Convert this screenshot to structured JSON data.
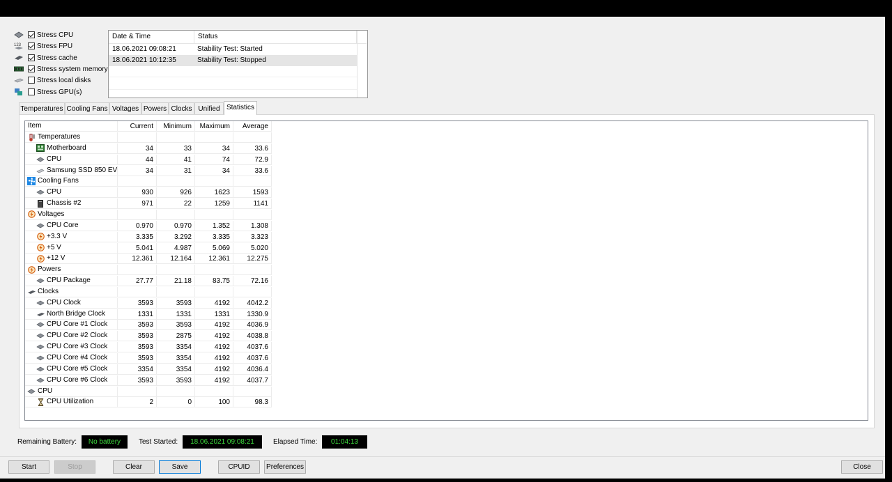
{
  "stress_options": [
    {
      "label": "Stress CPU",
      "checked": true,
      "icon": "cpu-chip-icon"
    },
    {
      "label": "Stress FPU",
      "checked": true,
      "icon": "fpu-123-icon"
    },
    {
      "label": "Stress cache",
      "checked": true,
      "icon": "cache-chip-icon"
    },
    {
      "label": "Stress system memory",
      "checked": true,
      "icon": "memory-module-icon"
    },
    {
      "label": "Stress local disks",
      "checked": false,
      "icon": "disk-drive-icon"
    },
    {
      "label": "Stress GPU(s)",
      "checked": false,
      "icon": "gpu-card-icon"
    }
  ],
  "log": {
    "headers": [
      "Date & Time",
      "Status"
    ],
    "rows": [
      {
        "datetime": "18.06.2021 09:08:21",
        "status": "Stability Test: Started"
      },
      {
        "datetime": "18.06.2021 10:12:35",
        "status": "Stability Test: Stopped"
      }
    ]
  },
  "tabs": [
    "Temperatures",
    "Cooling Fans",
    "Voltages",
    "Powers",
    "Clocks",
    "Unified",
    "Statistics"
  ],
  "active_tab": "Statistics",
  "stats": {
    "headers": [
      "Item",
      "Current",
      "Minimum",
      "Maximum",
      "Average"
    ],
    "rows": [
      {
        "group": true,
        "name": "Temperatures",
        "icon": "thermometer-icon"
      },
      {
        "name": "Motherboard",
        "icon": "motherboard-icon",
        "cur": "34",
        "min": "33",
        "max": "34",
        "avg": "33.6"
      },
      {
        "name": "CPU",
        "icon": "cpu-chip-icon",
        "cur": "44",
        "min": "41",
        "max": "74",
        "avg": "72.9"
      },
      {
        "name": "Samsung SSD 850 EV...",
        "icon": "ssd-icon",
        "cur": "34",
        "min": "31",
        "max": "34",
        "avg": "33.6"
      },
      {
        "group": true,
        "name": "Cooling Fans",
        "icon": "fan-icon"
      },
      {
        "name": "CPU",
        "icon": "cpu-chip-icon",
        "cur": "930",
        "min": "926",
        "max": "1623",
        "avg": "1593"
      },
      {
        "name": "Chassis #2",
        "icon": "chassis-icon",
        "cur": "971",
        "min": "22",
        "max": "1259",
        "avg": "1141"
      },
      {
        "group": true,
        "name": "Voltages",
        "icon": "voltage-icon"
      },
      {
        "name": "CPU Core",
        "icon": "cpu-chip-icon",
        "cur": "0.970",
        "min": "0.970",
        "max": "1.352",
        "avg": "1.308"
      },
      {
        "name": "+3.3 V",
        "icon": "voltage-icon",
        "cur": "3.335",
        "min": "3.292",
        "max": "3.335",
        "avg": "3.323"
      },
      {
        "name": "+5 V",
        "icon": "voltage-icon",
        "cur": "5.041",
        "min": "4.987",
        "max": "5.069",
        "avg": "5.020"
      },
      {
        "name": "+12 V",
        "icon": "voltage-icon",
        "cur": "12.361",
        "min": "12.164",
        "max": "12.361",
        "avg": "12.275"
      },
      {
        "group": true,
        "name": "Powers",
        "icon": "voltage-icon"
      },
      {
        "name": "CPU Package",
        "icon": "cpu-chip-icon",
        "cur": "27.77",
        "min": "21.18",
        "max": "83.75",
        "avg": "72.16"
      },
      {
        "group": true,
        "name": "Clocks",
        "icon": "clock-chip-icon"
      },
      {
        "name": "CPU Clock",
        "icon": "cpu-chip-icon",
        "cur": "3593",
        "min": "3593",
        "max": "4192",
        "avg": "4042.2"
      },
      {
        "name": "North Bridge Clock",
        "icon": "clock-chip-icon",
        "cur": "1331",
        "min": "1331",
        "max": "1331",
        "avg": "1330.9"
      },
      {
        "name": "CPU Core #1 Clock",
        "icon": "cpu-chip-icon",
        "cur": "3593",
        "min": "3593",
        "max": "4192",
        "avg": "4036.9"
      },
      {
        "name": "CPU Core #2 Clock",
        "icon": "cpu-chip-icon",
        "cur": "3593",
        "min": "2875",
        "max": "4192",
        "avg": "4038.8"
      },
      {
        "name": "CPU Core #3 Clock",
        "icon": "cpu-chip-icon",
        "cur": "3593",
        "min": "3354",
        "max": "4192",
        "avg": "4037.6"
      },
      {
        "name": "CPU Core #4 Clock",
        "icon": "cpu-chip-icon",
        "cur": "3593",
        "min": "3354",
        "max": "4192",
        "avg": "4037.6"
      },
      {
        "name": "CPU Core #5 Clock",
        "icon": "cpu-chip-icon",
        "cur": "3354",
        "min": "3354",
        "max": "4192",
        "avg": "4036.4"
      },
      {
        "name": "CPU Core #6 Clock",
        "icon": "cpu-chip-icon",
        "cur": "3593",
        "min": "3593",
        "max": "4192",
        "avg": "4037.7"
      },
      {
        "group": true,
        "name": "CPU",
        "icon": "cpu-chip-icon"
      },
      {
        "name": "CPU Utilization",
        "icon": "hourglass-icon",
        "cur": "2",
        "min": "0",
        "max": "100",
        "avg": "98.3"
      }
    ]
  },
  "status": {
    "battery_label": "Remaining Battery:",
    "battery_value": "No battery",
    "started_label": "Test Started:",
    "started_value": "18.06.2021 09:08:21",
    "elapsed_label": "Elapsed Time:",
    "elapsed_value": "01:04:13"
  },
  "buttons": {
    "start": "Start",
    "stop": "Stop",
    "clear": "Clear",
    "save": "Save",
    "cpuid": "CPUID",
    "preferences": "Preferences",
    "close": "Close"
  },
  "colors": {
    "led_text": "#3ddc3d",
    "led_bg": "#000000",
    "focus": "#0078d7"
  }
}
